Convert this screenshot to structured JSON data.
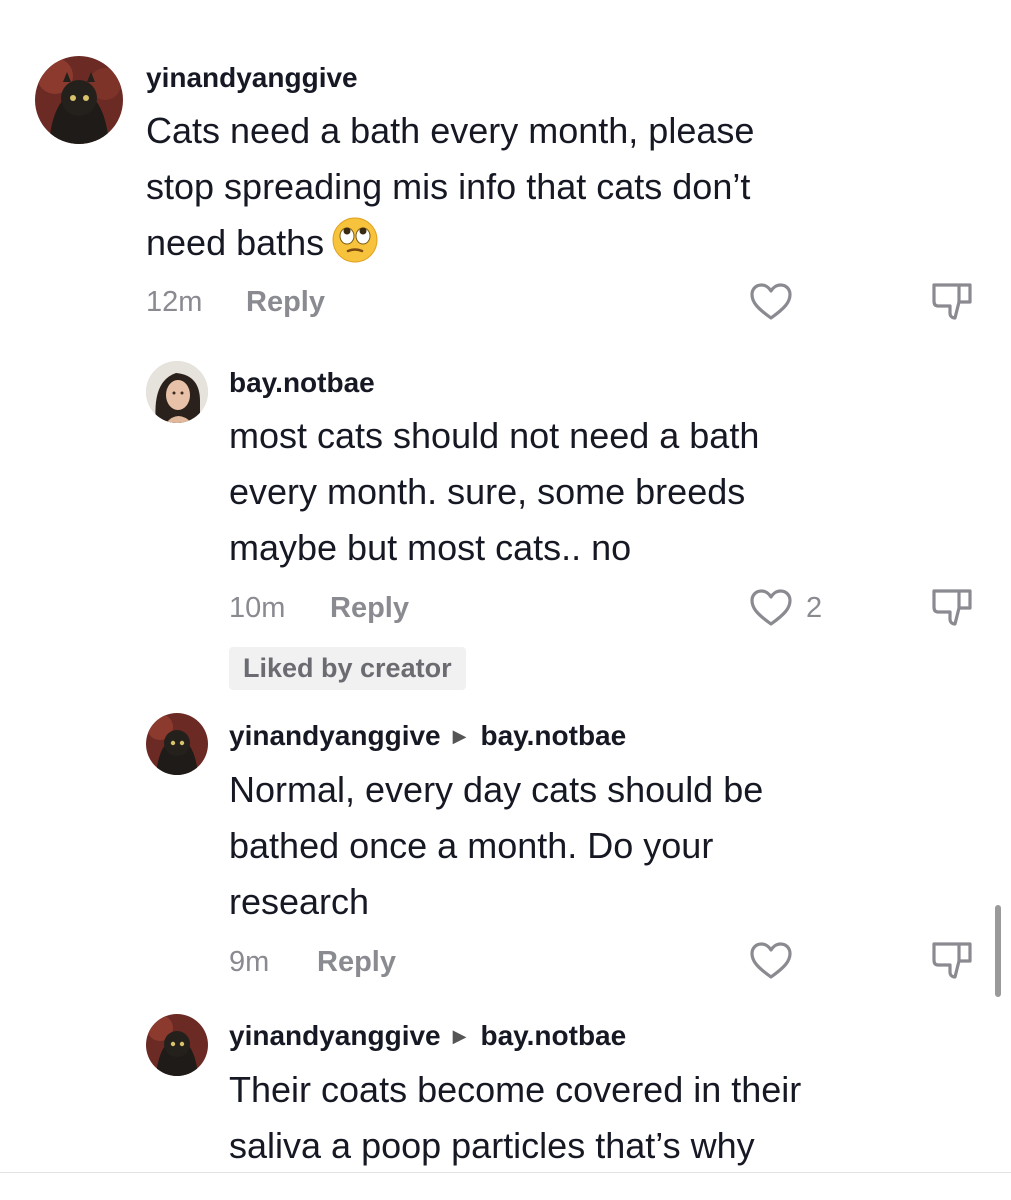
{
  "comments": [
    {
      "username": "yinandyanggive",
      "text_lines": [
        "Cats need a bath every month, please",
        "stop spreading mis info that cats don’t",
        "need baths"
      ],
      "emoji": "face-with-rolling-eyes-emoji",
      "time": "12m",
      "reply_label": "Reply",
      "likes": ""
    },
    {
      "username": "bay.notbae",
      "text_lines": [
        "most cats should not need a bath",
        "every month. sure, some breeds",
        "maybe but most cats.. no"
      ],
      "time": "10m",
      "reply_label": "Reply",
      "likes": "2",
      "badge": "Liked by creator"
    },
    {
      "username": "yinandyanggive",
      "reply_to": "bay.notbae",
      "text_lines": [
        "Normal, every day cats should be",
        "bathed once a month. Do your",
        "research"
      ],
      "time": "9m",
      "reply_label": "Reply",
      "likes": ""
    },
    {
      "username": "yinandyanggive",
      "reply_to": "bay.notbae",
      "text_lines": [
        "Their coats become covered in their",
        "saliva a poop particles that’s why"
      ]
    }
  ],
  "colors": {
    "text": "#161823",
    "muted": "#8a8b91",
    "badge_bg": "#f1f1f2"
  }
}
